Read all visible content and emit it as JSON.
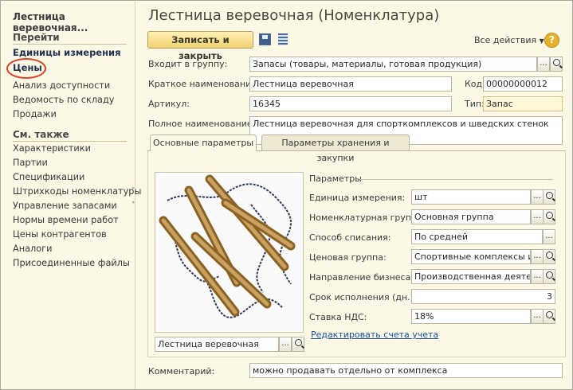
{
  "left_panel": {
    "title": "Лестница веревочная...",
    "goto_header": "Перейти",
    "goto_items": [
      "Единицы измерения",
      "Цены",
      "Анализ доступности",
      "Ведомость по складу",
      "Продажи"
    ],
    "see_also_header": "См. также",
    "see_also_items": [
      "Характеристики",
      "Партии",
      "Спецификации",
      "Штрихкоды номенклатуры",
      "Управление запасами",
      "Нормы времени работ",
      "Цены контрагентов",
      "Аналоги",
      "Присоединенные файлы"
    ]
  },
  "window": {
    "title": "Лестница веревочная (Номенклатура)",
    "save_close_label": "Записать и закрыть",
    "all_actions_label": "Все действия",
    "help_label": "?"
  },
  "form": {
    "group_label": "Входит в группу:",
    "group_value": "Запасы (товары, материалы, готовая продукция)",
    "short_name_label": "Краткое наименование:",
    "short_name_value": "Лестница веревочная",
    "code_label": "Код:",
    "code_value": "00000000012",
    "article_label": "Артикул:",
    "article_value": "16345",
    "type_label": "Тип:",
    "type_value": "Запас",
    "full_name_label": "Полное наименование:",
    "full_name_value": "Лестница веревочная для спорткомплексов и шведских стенок",
    "comment_label": "Комментарий:",
    "comment_value": "можно продавать отдельно от комплекса"
  },
  "tabs": [
    "Основные параметры",
    "Параметры хранения и закупки"
  ],
  "params": {
    "header": "Параметры",
    "unit_label": "Единица измерения:",
    "unit_value": "шт",
    "nom_group_label": "Номенклатурная группа:",
    "nom_group_value": "Основная группа",
    "writeoff_label": "Способ списания:",
    "writeoff_value": "По средней",
    "price_group_label": "Ценовая группа:",
    "price_group_value": "Спортивные комплексы и и",
    "business_label": "Направление бизнеса:",
    "business_value": "Производственная деятель",
    "term_label": "Срок исполнения (дн.):",
    "term_value": "3",
    "vat_label": "Ставка НДС:",
    "vat_value": "18%",
    "edit_accounts_link": "Редактировать счета учета"
  },
  "image": {
    "caption": "Лестница веревочная"
  }
}
